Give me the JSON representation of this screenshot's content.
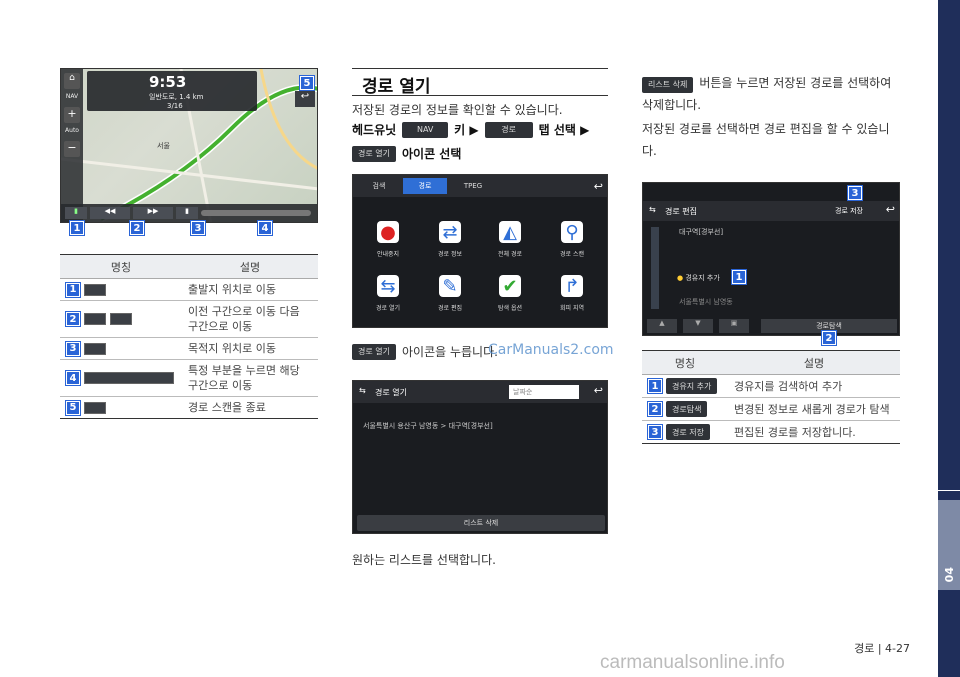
{
  "sidebar": {
    "chapter": "04"
  },
  "footer": {
    "page": "경로 | 4-27",
    "watermark": "carmanualsonline.info"
  },
  "screen1": {
    "time": "9:53",
    "road": "일반도로, 1.4 km",
    "progress": "3/16",
    "map_place": "서울",
    "left_buttons": [
      "NAV",
      "Auto"
    ]
  },
  "callouts": [
    "1",
    "2",
    "3",
    "4",
    "5"
  ],
  "table1": {
    "head": [
      "명칭",
      "설명"
    ],
    "rows": [
      {
        "num": "1",
        "desc": "출발지 위치로 이동"
      },
      {
        "num": "2",
        "desc": "이전 구간으로 이동 다음 구간으로 이동"
      },
      {
        "num": "3",
        "desc": "목적지 위치로 이동"
      },
      {
        "num": "4",
        "desc": "특정 부분을 누르면 해당 구간으로 이동"
      },
      {
        "num": "5",
        "desc": "경로 스캔을 종료"
      }
    ]
  },
  "mid": {
    "title": "경로 열기",
    "intro": "저장된 경로의 정보를 확인할 수 있습니다.",
    "step_prefix": "헤드유닛",
    "chip_nav": "NAV",
    "step_key": "키 ▶",
    "chip_route": "경로",
    "step_tab": "탭 선택 ▶",
    "chip_open": "경로 열기",
    "step_icon": "아이콘 선택",
    "step2": "아이콘을 누릅니다.",
    "watermark2": "CarManuals2.com",
    "final": "원하는 리스트를 선택합니다."
  },
  "menu_screen": {
    "tabs": [
      "검색",
      "경로",
      "TPEG"
    ],
    "items": [
      "안내중지",
      "경로 정보",
      "전체 경로",
      "경로 스캔",
      "경로 열기",
      "경로 편집",
      "탐색 옵션",
      "회피 지역"
    ]
  },
  "open_screen": {
    "title": "경로 열기",
    "sort": "날짜순",
    "route": "서울특별시 용산구 남영동 > 대구역[경부선]",
    "delete": "리스트 삭제"
  },
  "right": {
    "chip_delete": "리스트 삭제",
    "text1": "버튼을 누르면 저장된 경로를 선택하여 삭제합니다.",
    "text2": "저장된 경로를 선택하면 경로 편집을 할 수 있습니다."
  },
  "edit_screen": {
    "title": "경로 편집",
    "save": "경로 저장",
    "dest": "대구역[경부선]",
    "waypoint": "경유지 추가",
    "origin": "서울특별시 남영동",
    "search": "경로탐색"
  },
  "table2": {
    "head": [
      "명칭",
      "설명"
    ],
    "rows": [
      {
        "num": "1",
        "chip": "경유지 추가",
        "desc": "경유지를 검색하여 추가"
      },
      {
        "num": "2",
        "chip": "경로탐색",
        "desc": "변경된 정보로 새롭게 경로가 탐색"
      },
      {
        "num": "3",
        "chip": "경로 저장",
        "desc": "편집된 경로를 저장합니다."
      }
    ]
  }
}
